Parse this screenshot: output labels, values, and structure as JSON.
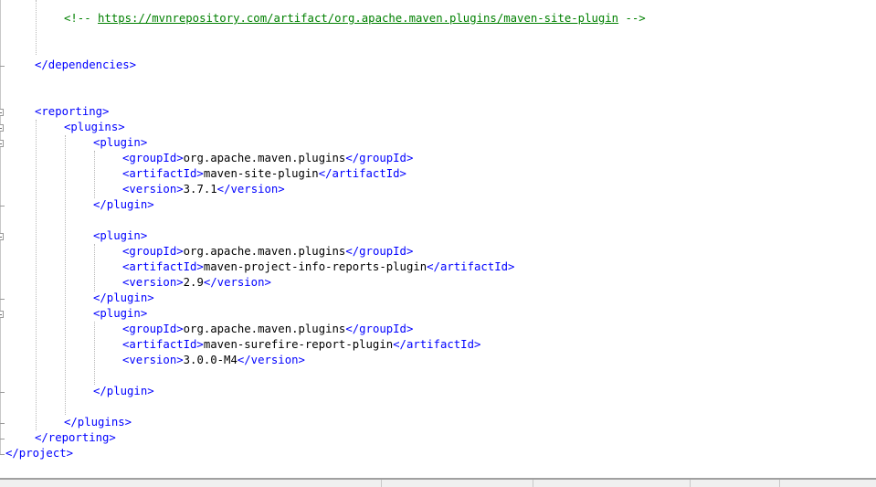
{
  "editor": {
    "language": "XML",
    "lines": [
      {
        "indent": 8,
        "tokens": [
          {
            "type": "comment",
            "text": "<!-- "
          },
          {
            "type": "link",
            "text": "https://mvnrepository.com/artifact/org.apache.maven.plugins/maven-site-plugin"
          },
          {
            "type": "comment",
            "text": " -->"
          }
        ]
      },
      {
        "indent": 0,
        "tokens": []
      },
      {
        "indent": 0,
        "tokens": []
      },
      {
        "indent": 4,
        "tokens": [
          {
            "type": "tag",
            "text": "</dependencies>"
          }
        ]
      },
      {
        "indent": 0,
        "tokens": []
      },
      {
        "indent": 0,
        "tokens": []
      },
      {
        "indent": 4,
        "tokens": [
          {
            "type": "tag",
            "text": "<reporting>"
          }
        ]
      },
      {
        "indent": 8,
        "tokens": [
          {
            "type": "tag",
            "text": "<plugins>"
          }
        ]
      },
      {
        "indent": 12,
        "tokens": [
          {
            "type": "tag",
            "text": "<plugin>"
          }
        ]
      },
      {
        "indent": 16,
        "tokens": [
          {
            "type": "tag",
            "text": "<groupId>"
          },
          {
            "type": "txt",
            "text": "org.apache.maven.plugins"
          },
          {
            "type": "tag",
            "text": "</groupId>"
          }
        ]
      },
      {
        "indent": 16,
        "tokens": [
          {
            "type": "tag",
            "text": "<artifactId>"
          },
          {
            "type": "txt",
            "text": "maven-site-plugin"
          },
          {
            "type": "tag",
            "text": "</artifactId>"
          }
        ]
      },
      {
        "indent": 16,
        "tokens": [
          {
            "type": "tag",
            "text": "<version>"
          },
          {
            "type": "txt",
            "text": "3.7.1"
          },
          {
            "type": "tag",
            "text": "</version>"
          }
        ]
      },
      {
        "indent": 12,
        "tokens": [
          {
            "type": "tag",
            "text": "</plugin>"
          }
        ]
      },
      {
        "indent": 0,
        "tokens": []
      },
      {
        "indent": 12,
        "tokens": [
          {
            "type": "tag",
            "text": "<plugin>"
          }
        ]
      },
      {
        "indent": 16,
        "tokens": [
          {
            "type": "tag",
            "text": "<groupId>"
          },
          {
            "type": "txt",
            "text": "org.apache.maven.plugins"
          },
          {
            "type": "tag",
            "text": "</groupId>"
          }
        ]
      },
      {
        "indent": 16,
        "tokens": [
          {
            "type": "tag",
            "text": "<artifactId>"
          },
          {
            "type": "txt",
            "text": "maven-project-info-reports-plugin"
          },
          {
            "type": "tag",
            "text": "</artifactId>"
          }
        ]
      },
      {
        "indent": 16,
        "tokens": [
          {
            "type": "tag",
            "text": "<version>"
          },
          {
            "type": "txt",
            "text": "2.9"
          },
          {
            "type": "tag",
            "text": "</version>"
          }
        ]
      },
      {
        "indent": 12,
        "tokens": [
          {
            "type": "tag",
            "text": "</plugin>"
          }
        ]
      },
      {
        "indent": 12,
        "tokens": [
          {
            "type": "tag",
            "text": "<plugin>"
          }
        ]
      },
      {
        "indent": 16,
        "tokens": [
          {
            "type": "tag",
            "text": "<groupId>"
          },
          {
            "type": "txt",
            "text": "org.apache.maven.plugins"
          },
          {
            "type": "tag",
            "text": "</groupId>"
          }
        ]
      },
      {
        "indent": 16,
        "tokens": [
          {
            "type": "tag",
            "text": "<artifactId>"
          },
          {
            "type": "txt",
            "text": "maven-surefire-report-plugin"
          },
          {
            "type": "tag",
            "text": "</artifactId>"
          }
        ]
      },
      {
        "indent": 16,
        "tokens": [
          {
            "type": "tag",
            "text": "<version>"
          },
          {
            "type": "txt",
            "text": "3.0.0-M4"
          },
          {
            "type": "tag",
            "text": "</version>"
          }
        ]
      },
      {
        "indent": 0,
        "tokens": []
      },
      {
        "indent": 12,
        "tokens": [
          {
            "type": "tag",
            "text": "</plugin>"
          }
        ]
      },
      {
        "indent": 0,
        "tokens": []
      },
      {
        "indent": 8,
        "tokens": [
          {
            "type": "tag",
            "text": "</plugins>"
          }
        ]
      },
      {
        "indent": 4,
        "tokens": [
          {
            "type": "tag",
            "text": "</reporting>"
          }
        ]
      },
      {
        "indent": 0,
        "tokens": [
          {
            "type": "tag",
            "text": "</project>"
          }
        ]
      }
    ]
  },
  "colors": {
    "tag": "#0000ff",
    "text": "#000000",
    "comment": "#008000",
    "background": "#ffffff"
  }
}
